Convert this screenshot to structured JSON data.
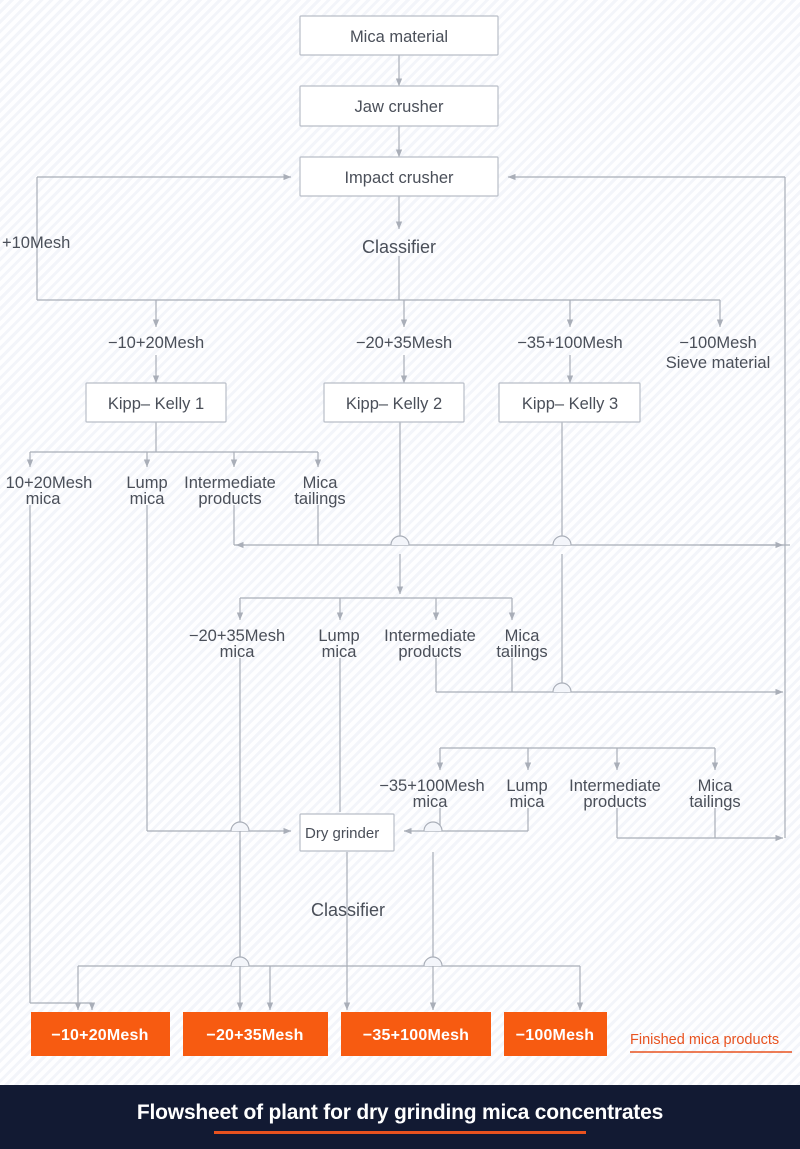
{
  "caption": {
    "title": "Flowsheet of plant for dry grinding mica concentrates",
    "accent_color": "#e8521f",
    "bar_color": "#121a33"
  },
  "colors": {
    "line": "#a9aeb8",
    "box_fill": "#ffffff",
    "box_border": "#b9bec8",
    "product_box": "#f75b11",
    "text": "#4a4f59",
    "background": "#f3f5fa"
  },
  "process_boxes": {
    "mica_material": "Mica material",
    "jaw_crusher": "Jaw crusher",
    "impact_crusher": "Impact crusher",
    "kipp_kelly_1": "Kipp– Kelly 1",
    "kipp_kelly_2": "Kipp– Kelly 2",
    "kipp_kelly_3": "Kipp– Kelly 3",
    "dry_grinder": "Dry grinder"
  },
  "unboxed_nodes": {
    "classifier_top": "Classifier",
    "classifier_bottom": "Classifier"
  },
  "classifier_streams": {
    "oversize": "+10Mesh",
    "s1": "−10+20Mesh",
    "s2": "−20+35Mesh",
    "s3": "−35+100Mesh",
    "s4_line1": "−100Mesh",
    "s4_line2": "Sieve material"
  },
  "kk1_outputs": {
    "product_line1": "10+20Mesh",
    "product_line2": "mica",
    "lump_line1": "Lump",
    "lump_line2": "mica",
    "intermediate_line1": "Intermediate",
    "intermediate_line2": "products",
    "tailings_line1": "Mica",
    "tailings_line2": "tailings"
  },
  "kk2_outputs": {
    "product_line1": "−20+35Mesh",
    "product_line2": "mica",
    "lump_line1": "Lump",
    "lump_line2": "mica",
    "intermediate_line1": "Intermediate",
    "intermediate_line2": "products",
    "tailings_line1": "Mica",
    "tailings_line2": "tailings"
  },
  "kk3_outputs": {
    "product_line1": "−35+100Mesh",
    "product_line2": "mica",
    "lump_line1": "Lump",
    "lump_line2": "mica",
    "intermediate_line1": "Intermediate",
    "intermediate_line2": "products",
    "tailings_line1": "Mica",
    "tailings_line2": "tailings"
  },
  "products": {
    "p1": "−10+20Mesh",
    "p2": "−20+35Mesh",
    "p3": "−35+100Mesh",
    "p4": "−100Mesh",
    "legend": "Finished mica products"
  }
}
